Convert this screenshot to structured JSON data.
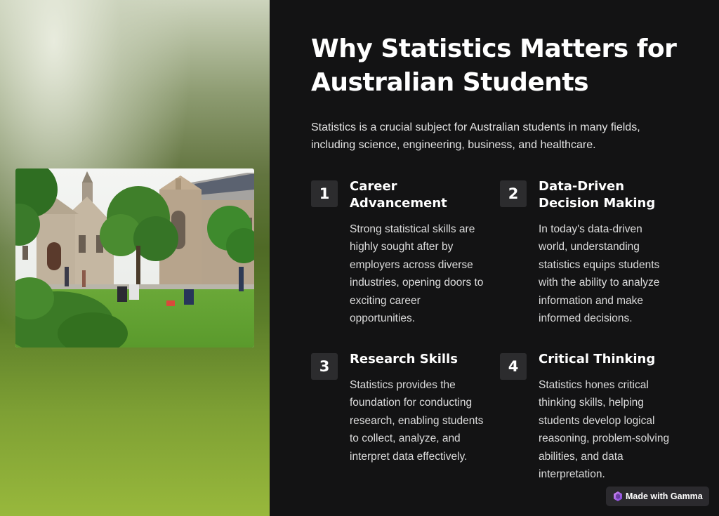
{
  "title_lines": [
    "Why Statistics Matters for",
    "Australian Students"
  ],
  "intro_lines": [
    "Statistics is a crucial subject for Australian students in many fields,",
    "including science, engineering, business, and healthcare."
  ],
  "items": [
    {
      "number": "1",
      "title_lines": [
        "Career",
        "Advancement"
      ],
      "body_lines": [
        "Strong statistical skills are",
        "highly sought after by",
        "employers across diverse",
        "industries, opening doors to",
        "exciting career",
        "opportunities."
      ]
    },
    {
      "number": "2",
      "title_lines": [
        "Data-Driven",
        "Decision Making"
      ],
      "body_lines": [
        "In today's data-driven",
        "world, understanding",
        "statistics equips students",
        "with the ability to analyze",
        "information and make",
        "informed decisions."
      ]
    },
    {
      "number": "3",
      "title_lines": [
        "Research Skills"
      ],
      "body_lines": [
        "Statistics provides the",
        "foundation for conducting",
        "research, enabling students",
        "to collect, analyze, and",
        "interpret data effectively."
      ]
    },
    {
      "number": "4",
      "title_lines": [
        "Critical Thinking"
      ],
      "body_lines": [
        "Statistics hones critical",
        "thinking skills, helping",
        "students develop logical",
        "reasoning, problem-solving",
        "abilities, and data",
        "interpretation."
      ]
    }
  ],
  "made_with": {
    "label": "Made with Gamma",
    "icon": "gamma-logo-icon"
  },
  "colors": {
    "background": "#131314",
    "heading": "#ffffff",
    "body_text": "#dcdcdc",
    "badge": "#2c2c2e"
  }
}
